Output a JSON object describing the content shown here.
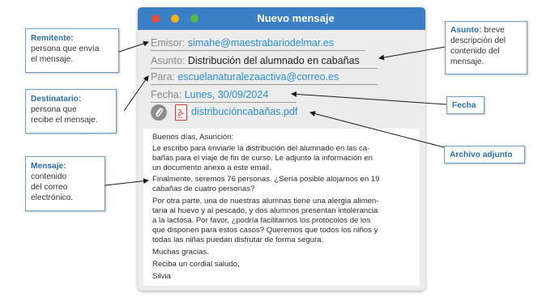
{
  "window": {
    "title": "Nuevo mensaje",
    "fields": {
      "from_label": "Emisor:",
      "from_value": "simahe@maestrabariodelmar.es",
      "subject_label": "Asunto:",
      "subject_value": "Distribución del alumnado en cabañas",
      "to_label": "Para:",
      "to_value": "escuelanaturalezaactiva@correo.es",
      "date_label": "Fecha:",
      "date_value": "Lunes, 30/09/2024"
    },
    "attachment": {
      "file_name": "distribucióncabañas.pdf",
      "pdf_badge": "PDF"
    },
    "message_lines": [
      "Buenos días, Asunción:",
      "Le escribo para enviarle la distribución del alumnado en las ca-",
      "bañas para el viaje de fin de curso. Le adjunto la información en",
      "un documento anexo a este email.",
      "Finalmente, seremos 76 personas. ¿Sería posible alojarnos en 19",
      "cabañas de cuatro personas?",
      "Por otra parte, una de nuestras alumnas tiene una alergia alimen-",
      "taria al huevo y al pescado, y dos alumnos presentan intolerancia",
      "a la lactosa. Por favor, ¿podría facilitarnos los protocolos de los",
      "que disponen para estos casos? Queremos que todos los niños y",
      "todas las niñas puedan disfrutar de forma segura.",
      "Muchas gracias.",
      "Reciba un cordial saludo,",
      "Silvia"
    ]
  },
  "callouts": {
    "remitente": {
      "title": "Remitente:",
      "lines": [
        "persona que envía",
        "el mensaje."
      ]
    },
    "destinatario": {
      "title": "Destinatario:",
      "lines": [
        "persona que",
        "recibe el mensaje."
      ]
    },
    "mensaje": {
      "title": "Mensaje:",
      "lines": [
        "contenido",
        "del correo",
        "electrónico."
      ]
    },
    "asunto": {
      "title": "Asunto:",
      "first_line_rest": " breve",
      "lines": [
        "descripción del",
        "contenido del",
        "mensaje."
      ]
    },
    "fecha": {
      "title": "Fecha"
    },
    "adjunto": {
      "title": "Archivo adjunto"
    }
  },
  "colors": {
    "titlebar": "#3b7fc4",
    "callout_title": "#2b6ea8",
    "link": "#2a8dd0",
    "callout_border": "#6a9cc8"
  }
}
